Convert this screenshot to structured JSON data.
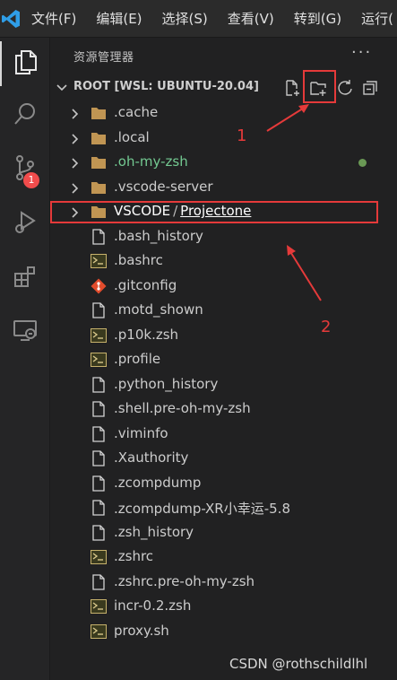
{
  "menubar": {
    "logo_icon": "vscode-logo",
    "items": [
      "文件(F)",
      "编辑(E)",
      "选择(S)",
      "查看(V)",
      "转到(G)",
      "运行("
    ]
  },
  "activitybar": {
    "items": [
      {
        "icon": "files-icon",
        "active": true
      },
      {
        "icon": "search-icon"
      },
      {
        "icon": "source-control-icon",
        "badge": "1"
      },
      {
        "icon": "run-debug-icon"
      },
      {
        "icon": "extensions-icon"
      },
      {
        "icon": "remote-explorer-icon"
      }
    ]
  },
  "sidebar": {
    "title": "资源管理器",
    "more": "···",
    "section": {
      "title": "ROOT [WSL: UBUNTU-20.04]",
      "actions": [
        "new-file-icon",
        "new-folder-icon",
        "refresh-icon",
        "collapse-all-icon"
      ]
    },
    "tree": [
      {
        "label": ".cache",
        "type": "folder"
      },
      {
        "label": ".local",
        "type": "folder"
      },
      {
        "label": ".oh-my-zsh",
        "type": "folder",
        "color": "#73c991",
        "modified_dot": true
      },
      {
        "label": ".vscode-server",
        "type": "folder"
      },
      {
        "label": "VSCODE",
        "sep": "/",
        "sub": "Projectone",
        "type": "folder",
        "selected": true
      },
      {
        "label": ".bash_history",
        "type": "file"
      },
      {
        "label": ".bashrc",
        "type": "shell"
      },
      {
        "label": ".gitconfig",
        "type": "git"
      },
      {
        "label": ".motd_shown",
        "type": "file"
      },
      {
        "label": ".p10k.zsh",
        "type": "shell"
      },
      {
        "label": ".profile",
        "type": "shell"
      },
      {
        "label": ".python_history",
        "type": "file"
      },
      {
        "label": ".shell.pre-oh-my-zsh",
        "type": "file"
      },
      {
        "label": ".viminfo",
        "type": "file"
      },
      {
        "label": ".Xauthority",
        "type": "file"
      },
      {
        "label": ".zcompdump",
        "type": "file"
      },
      {
        "label": ".zcompdump-XR小幸运-5.8",
        "type": "file"
      },
      {
        "label": ".zsh_history",
        "type": "file"
      },
      {
        "label": ".zshrc",
        "type": "shell"
      },
      {
        "label": ".zshrc.pre-oh-my-zsh",
        "type": "file"
      },
      {
        "label": "incr-0.2.zsh",
        "type": "shell"
      },
      {
        "label": "proxy.sh",
        "type": "shell"
      }
    ]
  },
  "annotations": {
    "label_1": "1",
    "label_2": "2",
    "color": "#e53a3a"
  },
  "watermark": "CSDN @rothschildlhl"
}
